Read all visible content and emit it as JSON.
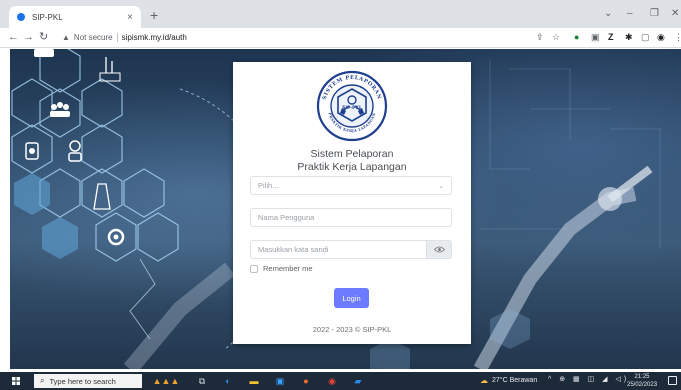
{
  "browser": {
    "tab_title": "SIP-PKL",
    "tab_close": "×",
    "new_tab": "+",
    "security_label": "Not secure",
    "url": "sipismk.my.id/auth"
  },
  "login": {
    "logo_text_top": "SISTEM PELAPORAN",
    "logo_text_bottom": "PRAKTIK KERJA LAPANGAN",
    "logo_center": "SIP-PKL",
    "title_line1": "Sistem Pelaporan",
    "title_line2": "Praktik Kerja Lapangan",
    "select_placeholder": "Pilih...",
    "username_placeholder": "Nama Pengguna",
    "password_placeholder": "Masukkan kata sandi",
    "remember_label": "Remember me",
    "login_button": "Login",
    "footer": "2022 - 2023 © SIP-PKL"
  },
  "taskbar": {
    "search_placeholder": "Type here to search",
    "weather": "27°C Berawan",
    "time": "21:25",
    "date": "25/02/2023"
  },
  "colors": {
    "accent": "#6c7bff",
    "logo_blue": "#1f3f8f",
    "background": "#2c4866"
  }
}
